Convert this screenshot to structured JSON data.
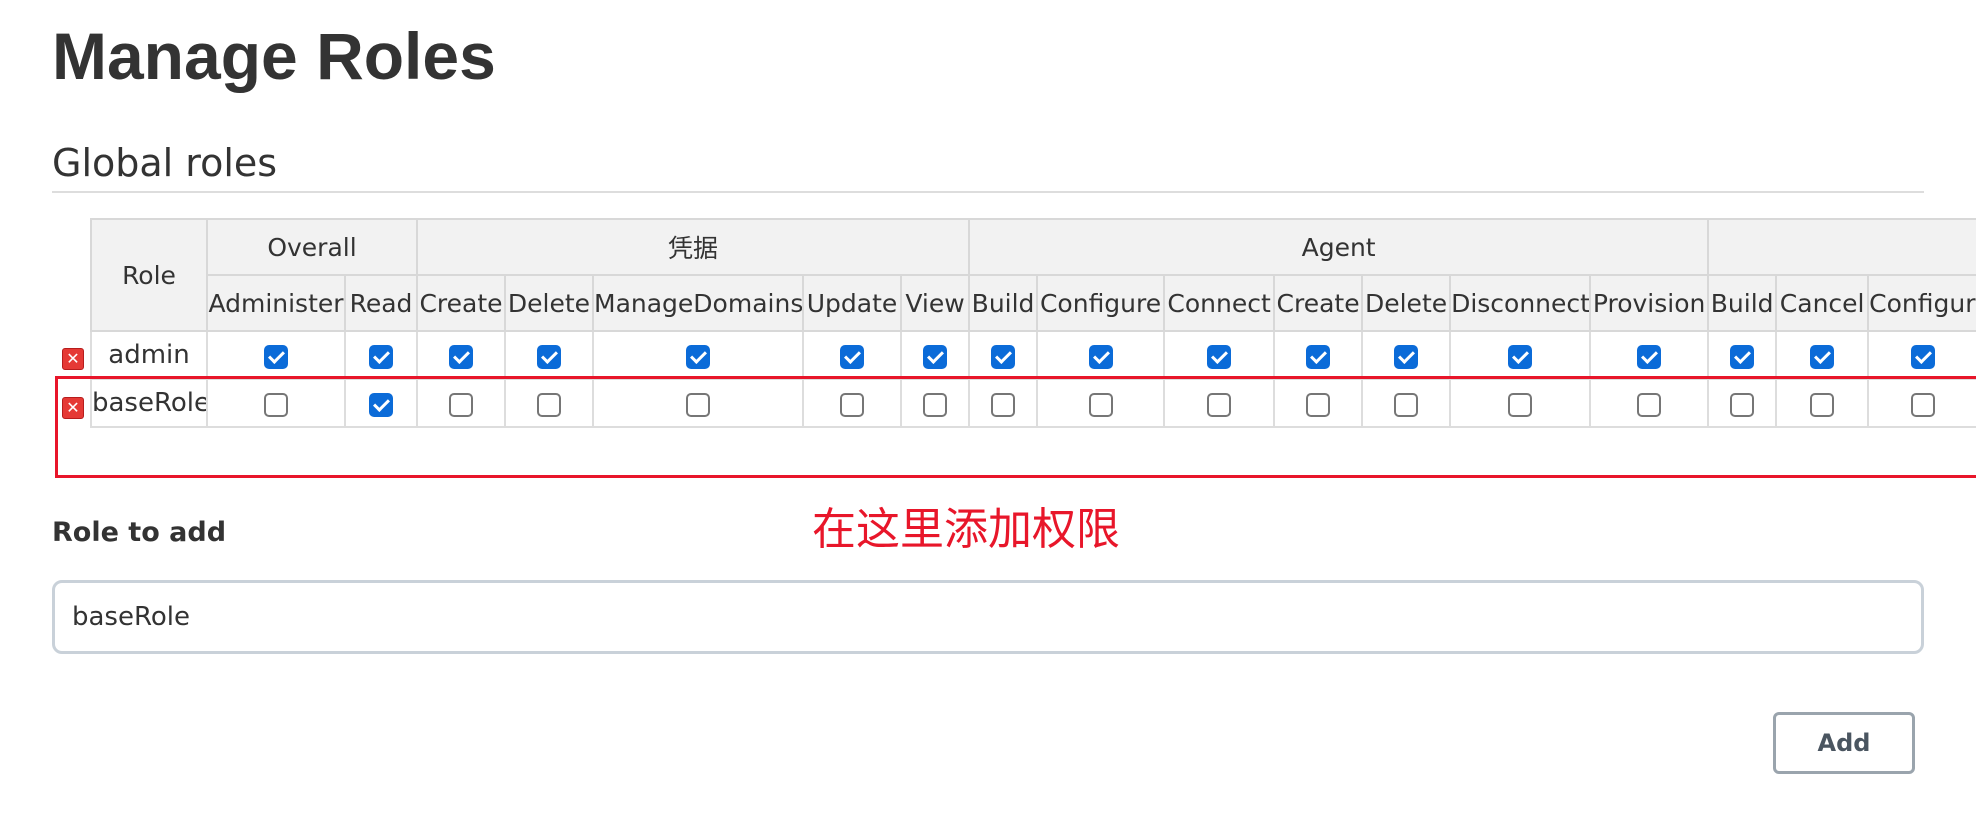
{
  "page": {
    "title": "Manage Roles",
    "section_title": "Global roles"
  },
  "table": {
    "role_header": "Role",
    "groups": [
      {
        "label": "Overall",
        "span": 2
      },
      {
        "label": "凭据",
        "span": 5
      },
      {
        "label": "Agent",
        "span": 7
      },
      {
        "label": "",
        "span": 3
      }
    ],
    "permissions": [
      "Administer",
      "Read",
      "Create",
      "Delete",
      "ManageDomains",
      "Update",
      "View",
      "Build",
      "Configure",
      "Connect",
      "Create",
      "Delete",
      "Disconnect",
      "Provision",
      "Build",
      "Cancel",
      "Configure"
    ],
    "rows": [
      {
        "name": "admin",
        "checks": [
          true,
          true,
          true,
          true,
          true,
          true,
          true,
          true,
          true,
          true,
          true,
          true,
          true,
          true,
          true,
          true,
          true
        ]
      },
      {
        "name": "baseRole",
        "checks": [
          false,
          true,
          false,
          false,
          false,
          false,
          false,
          false,
          false,
          false,
          false,
          false,
          false,
          false,
          false,
          false,
          false
        ]
      }
    ],
    "delete_icon": "remove-icon"
  },
  "annotation": "在这里添加权限",
  "form": {
    "label": "Role to add",
    "input_value": "baseRole",
    "add_label": "Add"
  },
  "colors": {
    "checkbox_checked": "#0b6bd8",
    "annotation_red": "#e8162a",
    "header_bg": "#f2f2f2"
  }
}
